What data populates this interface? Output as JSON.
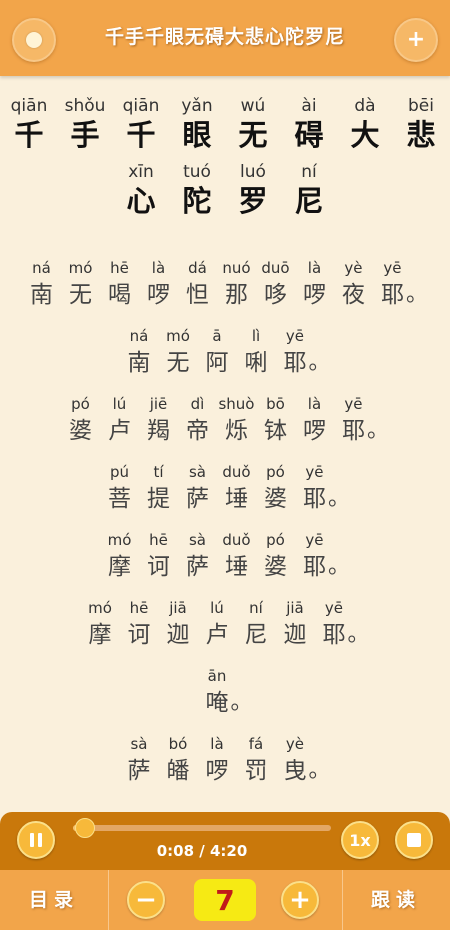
{
  "header": {
    "title": "千手千眼无碍大悲心陀罗尼",
    "left_icon": "moon-icon",
    "right_icon": "plus-icon",
    "right_label": "+"
  },
  "title_lines": [
    [
      {
        "py": "qiān",
        "ch": "千"
      },
      {
        "py": "shǒu",
        "ch": "手"
      },
      {
        "py": "qiān",
        "ch": "千"
      },
      {
        "py": "yǎn",
        "ch": "眼"
      },
      {
        "py": "wú",
        "ch": "无"
      },
      {
        "py": "ài",
        "ch": "碍"
      },
      {
        "py": "dà",
        "ch": "大"
      },
      {
        "py": "bēi",
        "ch": "悲"
      }
    ],
    [
      {
        "py": "xīn",
        "ch": "心"
      },
      {
        "py": "tuó",
        "ch": "陀"
      },
      {
        "py": "luó",
        "ch": "罗"
      },
      {
        "py": "ní",
        "ch": "尼"
      }
    ]
  ],
  "verses": [
    {
      "chars": [
        {
          "py": "ná",
          "ch": "南"
        },
        {
          "py": "mó",
          "ch": "无"
        },
        {
          "py": "hē",
          "ch": "喝"
        },
        {
          "py": "là",
          "ch": "啰"
        },
        {
          "py": "dá",
          "ch": "怛"
        },
        {
          "py": "nuó",
          "ch": "那"
        },
        {
          "py": "duō",
          "ch": "哆"
        },
        {
          "py": "là",
          "ch": "啰"
        },
        {
          "py": "yè",
          "ch": "夜"
        },
        {
          "py": "yē",
          "ch": "耶"
        }
      ],
      "end": "。"
    },
    {
      "chars": [
        {
          "py": "ná",
          "ch": "南"
        },
        {
          "py": "mó",
          "ch": "无"
        },
        {
          "py": "ā",
          "ch": "阿"
        },
        {
          "py": "lì",
          "ch": "唎"
        },
        {
          "py": "yē",
          "ch": "耶"
        }
      ],
      "end": "。"
    },
    {
      "chars": [
        {
          "py": "pó",
          "ch": "婆"
        },
        {
          "py": "lú",
          "ch": "卢"
        },
        {
          "py": "jiē",
          "ch": "羯"
        },
        {
          "py": "dì",
          "ch": "帝"
        },
        {
          "py": "shuò",
          "ch": "烁"
        },
        {
          "py": "bō",
          "ch": "钵"
        },
        {
          "py": "là",
          "ch": "啰"
        },
        {
          "py": "yē",
          "ch": "耶"
        }
      ],
      "end": "。"
    },
    {
      "chars": [
        {
          "py": "pú",
          "ch": "菩"
        },
        {
          "py": "tí",
          "ch": "提"
        },
        {
          "py": "sà",
          "ch": "萨"
        },
        {
          "py": "duǒ",
          "ch": "埵"
        },
        {
          "py": "pó",
          "ch": "婆"
        },
        {
          "py": "yē",
          "ch": "耶"
        }
      ],
      "end": "。"
    },
    {
      "chars": [
        {
          "py": "mó",
          "ch": "摩"
        },
        {
          "py": "hē",
          "ch": "诃"
        },
        {
          "py": "sà",
          "ch": "萨"
        },
        {
          "py": "duǒ",
          "ch": "埵"
        },
        {
          "py": "pó",
          "ch": "婆"
        },
        {
          "py": "yē",
          "ch": "耶"
        }
      ],
      "end": "。"
    },
    {
      "chars": [
        {
          "py": "mó",
          "ch": "摩"
        },
        {
          "py": "hē",
          "ch": "诃"
        },
        {
          "py": "jiā",
          "ch": "迦"
        },
        {
          "py": "lú",
          "ch": "卢"
        },
        {
          "py": "ní",
          "ch": "尼"
        },
        {
          "py": "jiā",
          "ch": "迦"
        },
        {
          "py": "yē",
          "ch": "耶"
        }
      ],
      "end": "。"
    },
    {
      "chars": [
        {
          "py": "ān",
          "ch": "唵"
        }
      ],
      "end": "。"
    },
    {
      "chars": [
        {
          "py": "sà",
          "ch": "萨"
        },
        {
          "py": "bó",
          "ch": "皤"
        },
        {
          "py": "là",
          "ch": "啰"
        },
        {
          "py": "fá",
          "ch": "罚"
        },
        {
          "py": "yè",
          "ch": "曳"
        }
      ],
      "end": "。"
    }
  ],
  "player": {
    "time": "0:08 / 4:20",
    "progress": 0.03,
    "speed": "1x",
    "pause_icon": "pause-icon",
    "stop_icon": "stop-icon"
  },
  "bottom": {
    "menu_label": "目录",
    "minus_label": "−",
    "count": "7",
    "plus_label": "+",
    "follow_label": "跟读"
  },
  "colors": {
    "header": "#f2a54a",
    "background": "#faf0dc",
    "player": "#c9780b",
    "count_box": "#f6ea14",
    "count_text": "#c11a1a"
  }
}
